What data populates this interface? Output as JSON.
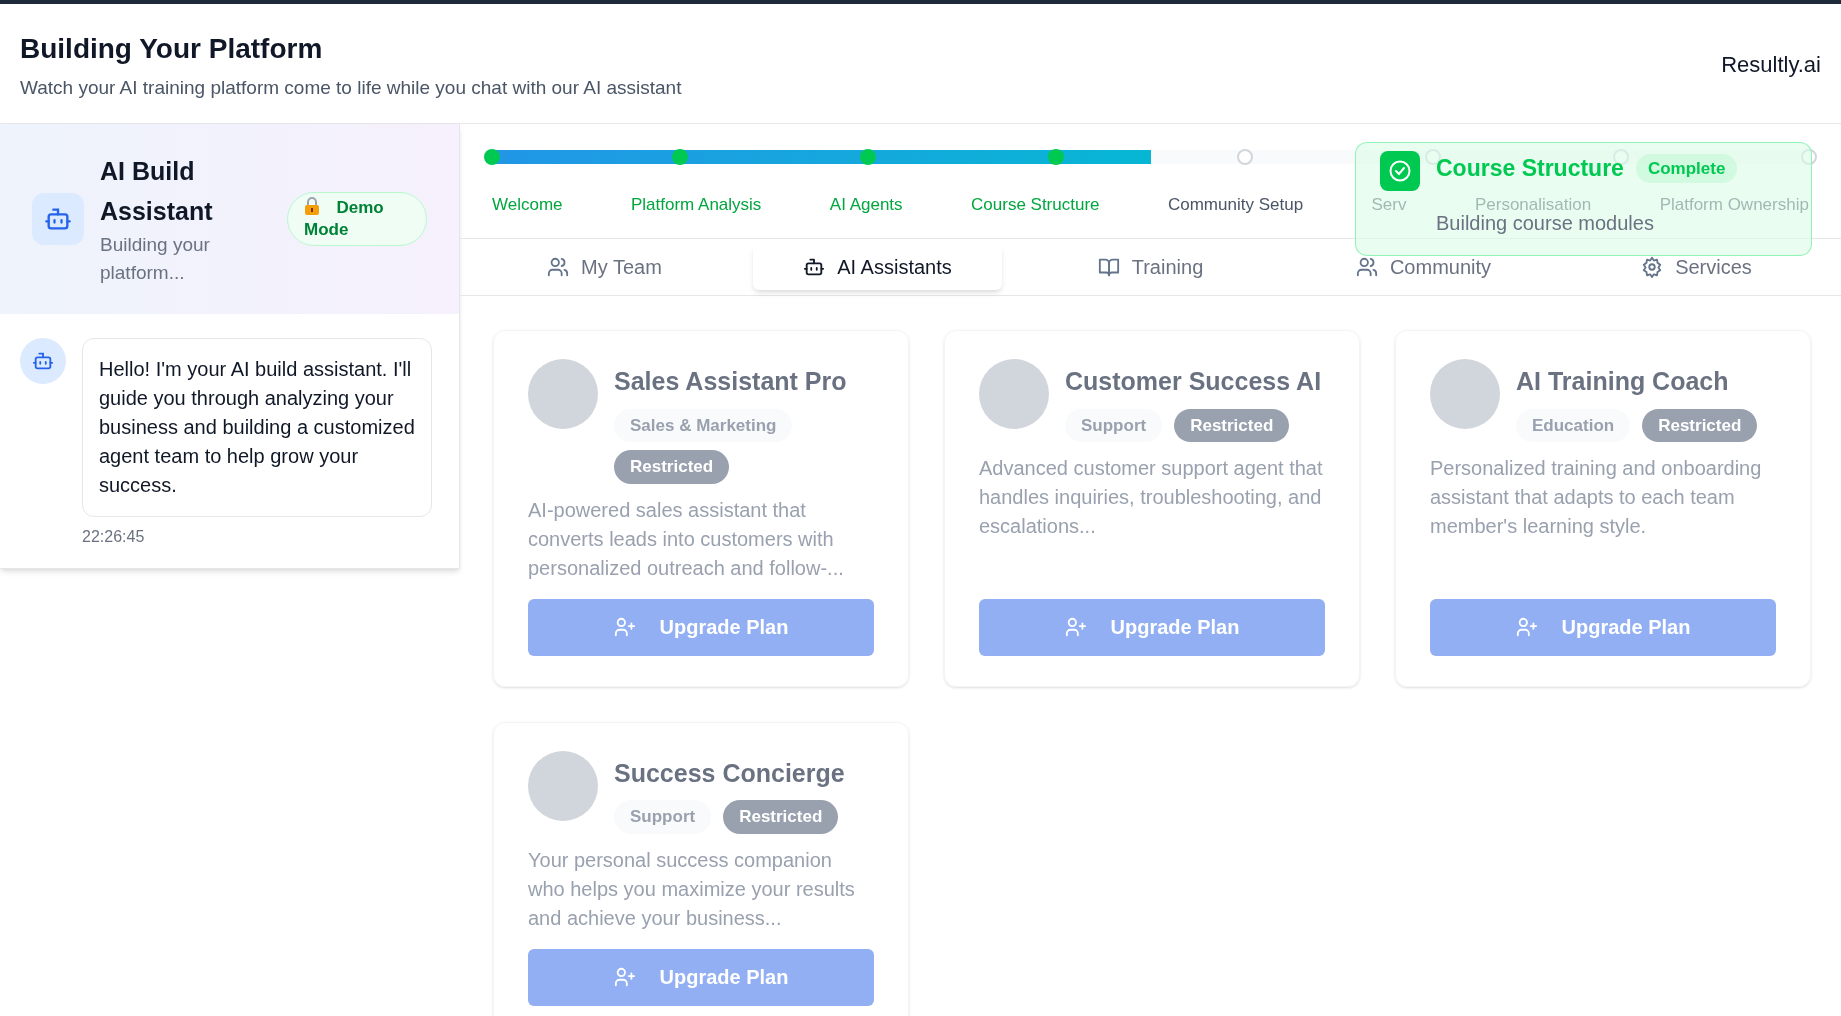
{
  "header": {
    "title": "Building Your Platform",
    "subtitle": "Watch your AI training platform come to life while you chat with our AI assistant",
    "brand": "Resultly.ai"
  },
  "assistant": {
    "title": "AI Build Assistant",
    "subtitle": "Building your platform...",
    "badge": "Demo Mode"
  },
  "messages": [
    {
      "text": "Hello! I'm your AI build assistant. I'll guide you through analyzing your business and building a customized agent team to help grow your success.",
      "time": "22:26:45"
    }
  ],
  "progress": {
    "level": 0.5,
    "steps": [
      {
        "label": "Welcome",
        "completed": true
      },
      {
        "label": "Platform Analysis",
        "completed": true
      },
      {
        "label": "AI Agents",
        "completed": true
      },
      {
        "label": "Course Structure",
        "completed": true
      },
      {
        "label": "Community Setup",
        "completed": false
      },
      {
        "label": "Serv",
        "completed": false
      },
      {
        "label": "Personalisation",
        "completed": false
      },
      {
        "label": "Platform Ownership",
        "completed": false
      }
    ]
  },
  "toast": {
    "title": "Course Structure",
    "status": "Complete",
    "message": "Building course modules"
  },
  "tabs": [
    {
      "label": "My Team",
      "selected": false
    },
    {
      "label": "AI Assistants",
      "selected": true
    },
    {
      "label": "Training",
      "selected": false
    },
    {
      "label": "Community",
      "selected": false
    },
    {
      "label": "Services",
      "selected": false
    }
  ],
  "agents": [
    {
      "name": "Sales Assistant Pro",
      "tags": [
        {
          "label": "Sales & Marketing",
          "kind": "category"
        },
        {
          "label": "Restricted",
          "kind": "status"
        }
      ],
      "description": "AI-powered sales assistant that converts leads into customers with personalized outreach and follow-...",
      "button": "Upgrade Plan"
    },
    {
      "name": "Customer Success AI",
      "tags": [
        {
          "label": "Support",
          "kind": "category"
        },
        {
          "label": "Restricted",
          "kind": "status"
        }
      ],
      "description": "Advanced customer support agent that handles inquiries, troubleshooting, and escalations...",
      "button": "Upgrade Plan"
    },
    {
      "name": "AI Training Coach",
      "tags": [
        {
          "label": "Education",
          "kind": "category"
        },
        {
          "label": "Restricted",
          "kind": "status"
        }
      ],
      "description": "Personalized training and onboarding assistant that adapts to each team member's learning style.",
      "button": "Upgrade Plan"
    },
    {
      "name": "Success Concierge",
      "tags": [
        {
          "label": "Support",
          "kind": "category"
        },
        {
          "label": "Restricted",
          "kind": "status"
        }
      ],
      "description": "Your personal success companion who helps you maximize your results and achieve your business...",
      "button": "Upgrade Plan"
    }
  ]
}
